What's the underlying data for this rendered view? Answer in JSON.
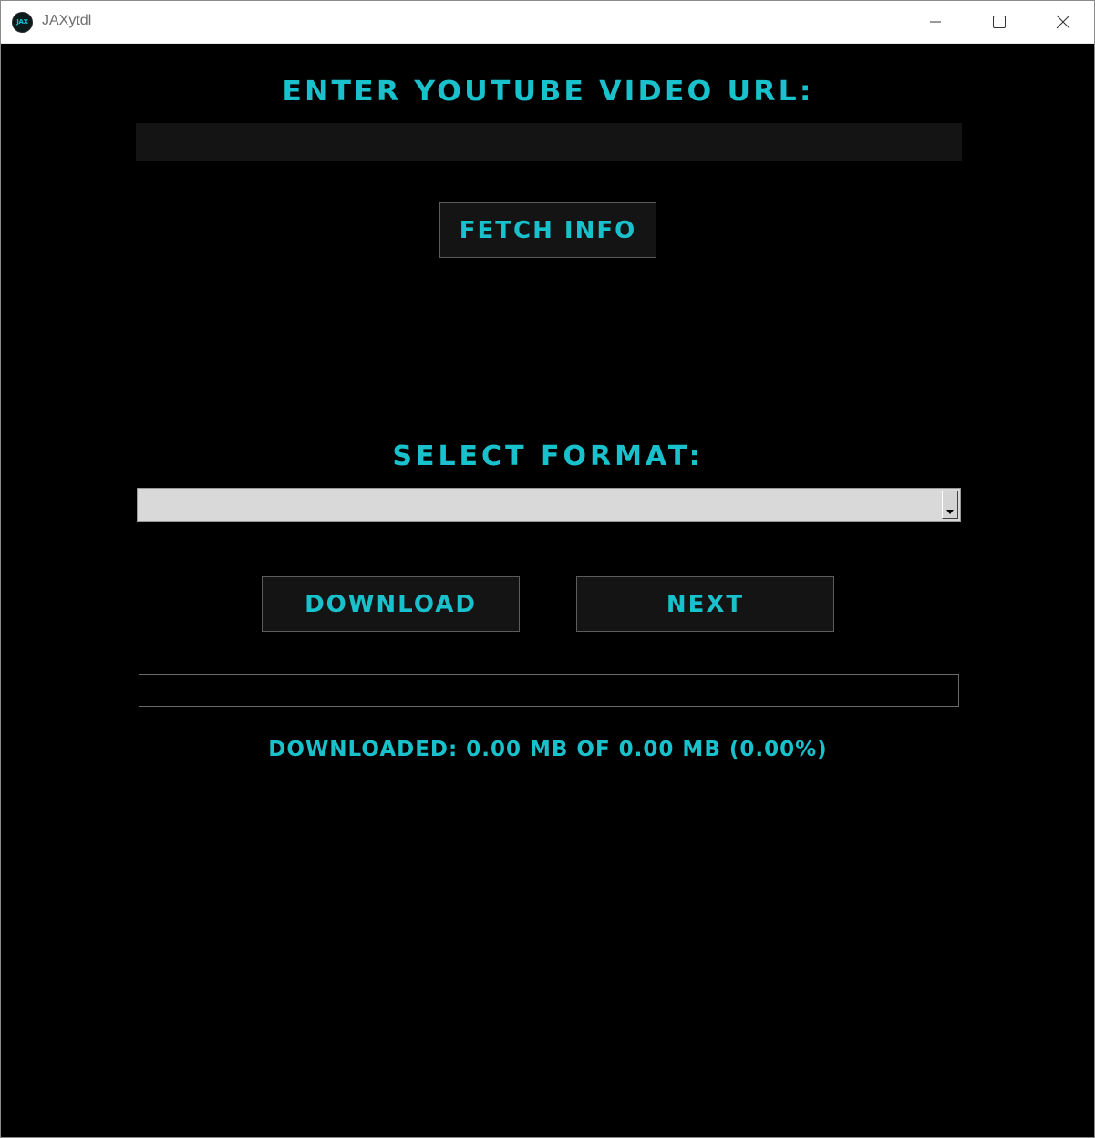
{
  "window": {
    "title": "JAXytdl",
    "icon_text": "JAX",
    "controls": [
      "minimize-icon",
      "maximize-icon",
      "close-icon"
    ]
  },
  "url_section": {
    "label": "ENTER YOUTUBE VIDEO URL:",
    "input_value": ""
  },
  "fetch_button": {
    "label": "FETCH INFO"
  },
  "format_section": {
    "label": "SELECT FORMAT:",
    "selected": ""
  },
  "actions": {
    "download_label": "DOWNLOAD",
    "next_label": "NEXT"
  },
  "progress": {
    "fraction": 0.0
  },
  "status": {
    "text": "DOWNLOADED: 0.00 MB OF 0.00 MB (0.00%)"
  },
  "colors": {
    "accent": "#19c1cc",
    "background": "#000000",
    "button_bg": "#141414",
    "select_bg": "#d9d9d9"
  }
}
